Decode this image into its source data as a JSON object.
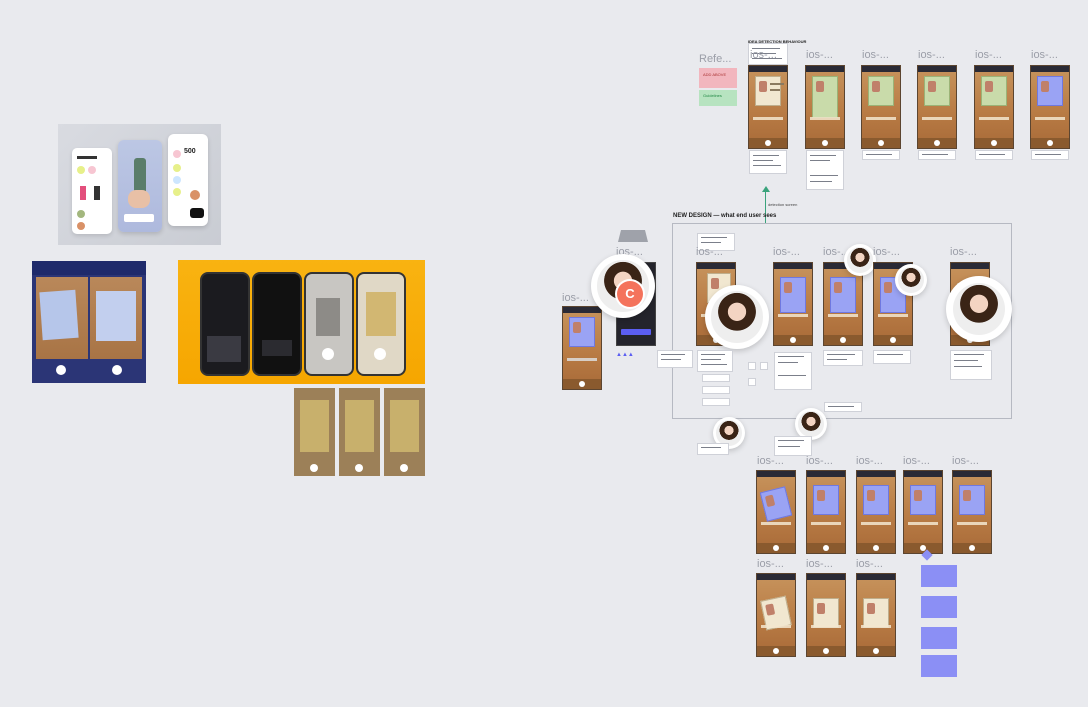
{
  "canvas": {
    "background": "#e9eaee"
  },
  "frames": {
    "ios_label": "ios-...",
    "references_label": "Refe..."
  },
  "sections": {
    "new_design_title": "NEW DESIGN — what end user sees",
    "top_title": "IDEA DETECTION BEHAVIOUR",
    "arrow_label": "detection screen"
  },
  "sticky": {
    "pink_title": "ADD ABOVE",
    "green_title": "Guidelines"
  },
  "avatars": {
    "initial_c": "C"
  },
  "mini_apps": {
    "balance": "500"
  },
  "colors": {
    "accent_purple": "#8b8ff5",
    "wood": "#b97c45",
    "orange_yellow": "#f9b311",
    "navy": "#1e2a6b",
    "coral": "#f4735c"
  }
}
